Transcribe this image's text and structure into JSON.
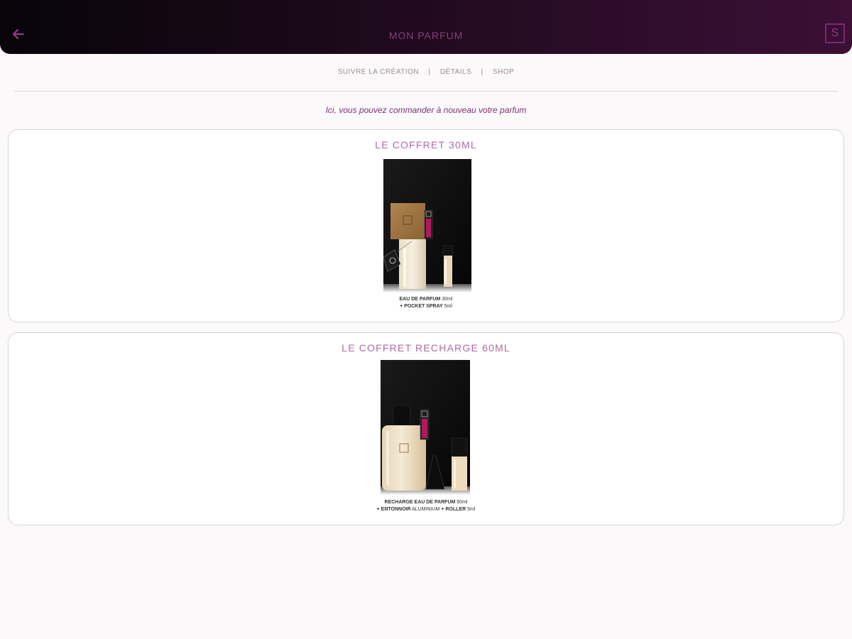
{
  "header": {
    "title": "MON PARFUM",
    "back_icon": "arrow-left-icon",
    "logo_letter": "S",
    "accent": "#8a3c80"
  },
  "subnav": {
    "items": [
      "SUIVRE LA CRÉATION",
      "DÉTAILS",
      "SHOP"
    ],
    "separator": "|"
  },
  "intro": "Ici, vous pouvez commander à nouveau votre parfum",
  "products": [
    {
      "title": "LE COFFRET 30ML",
      "caption_line1_bold": "EAU DE PARFUM",
      "caption_line1_rest": " 30ml",
      "caption_line2_bold": "+ POCKET SPRAY",
      "caption_line2_rest": " 5ml"
    },
    {
      "title": "LE COFFRET RECHARGE 60ML",
      "caption_line1_bold": "RECHARGE EAU DE PARFUM",
      "caption_line1_rest": " 60ml",
      "caption_line2_bold": "+ ENTONNOIR",
      "caption_line2_mid": " ALUMINIUM ",
      "caption_line2_bold2": "+ ROLLER",
      "caption_line2_rest": " 5ml"
    }
  ]
}
